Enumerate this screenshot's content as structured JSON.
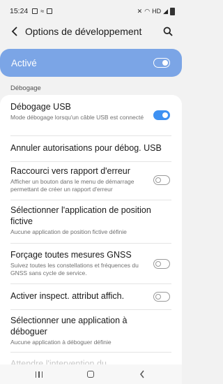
{
  "status_bar": {
    "time": "15:24",
    "right_text": "HD"
  },
  "header": {
    "title": "Options de développement",
    "back_icon": "arrow-back-icon",
    "search_icon": "search-icon"
  },
  "master": {
    "label": "Activé",
    "enabled": true,
    "color": "#7ba5e6"
  },
  "section": {
    "label": "Débogage"
  },
  "items": [
    {
      "title": "Débogage USB",
      "subtitle": "Mode débogage lorsqu'un câble USB est connecté",
      "toggle": "on"
    },
    {
      "title": "Annuler autorisations pour débog. USB",
      "subtitle": "",
      "toggle": null
    },
    {
      "title": "Raccourci vers rapport d'erreur",
      "subtitle": "Afficher un bouton dans le menu de démarrage permettant de créer un rapport d'erreur",
      "toggle": "off"
    },
    {
      "title": "Sélectionner l'application de position fictive",
      "subtitle": "Aucune application de position fictive définie",
      "toggle": null
    },
    {
      "title": "Forçage toutes mesures GNSS",
      "subtitle": "Suivez toutes les constellations et fréquences du GNSS sans cycle de service.",
      "toggle": "off"
    },
    {
      "title": "Activer inspect. attribut affich.",
      "subtitle": "",
      "toggle": "off"
    },
    {
      "title": "Sélectionner une application à déboguer",
      "subtitle": "Aucune application à déboguer définie",
      "toggle": null
    },
    {
      "title": "Attendre l'intervention du",
      "subtitle": "",
      "toggle": null
    }
  ],
  "colors": {
    "accent": "#3e91f2",
    "background": "#f2f2f2"
  }
}
